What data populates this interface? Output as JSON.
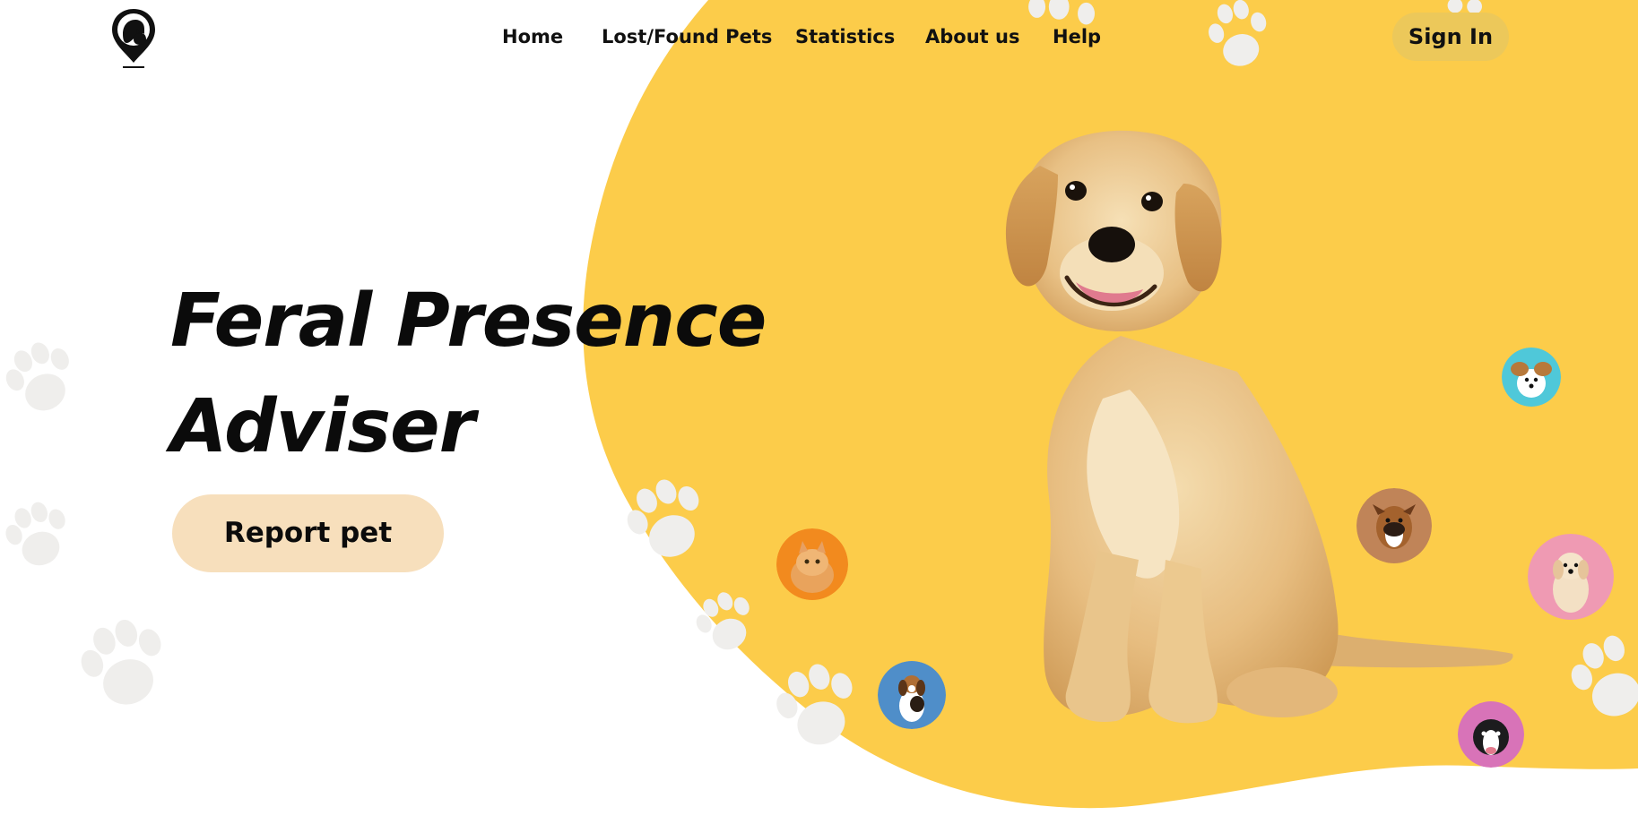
{
  "nav": {
    "items": [
      {
        "label": "Home"
      },
      {
        "label": "Lost/Found Pets"
      },
      {
        "label": "Statistics"
      },
      {
        "label": "About us"
      },
      {
        "label": "Help"
      }
    ],
    "sign_in_label": "Sign In"
  },
  "hero": {
    "title_line1": "Feral Presence",
    "title_line2": "Adviser",
    "report_button_label": "Report pet"
  },
  "colors": {
    "accent_yellow": "#fccc4a",
    "sign_in_bg": "#ecc85a",
    "report_button_bg": "#f7dfbc",
    "paw_light": "#efeeec",
    "text": "#111111"
  },
  "icons": {
    "logo": "pet-location-pin-icon",
    "paw": "paw-print-icon"
  },
  "avatars": [
    {
      "name": "orange-cat-avatar",
      "bg": "#f28a1e"
    },
    {
      "name": "beagle-avatar",
      "bg": "#4f8ec9"
    },
    {
      "name": "boxer-avatar",
      "bg": "#c08458"
    },
    {
      "name": "papillon-avatar",
      "bg": "#4fc8d9"
    },
    {
      "name": "golden-puppy-avatar",
      "bg": "#ef9ab3"
    },
    {
      "name": "border-collie-avatar",
      "bg": "#d873b8"
    }
  ]
}
